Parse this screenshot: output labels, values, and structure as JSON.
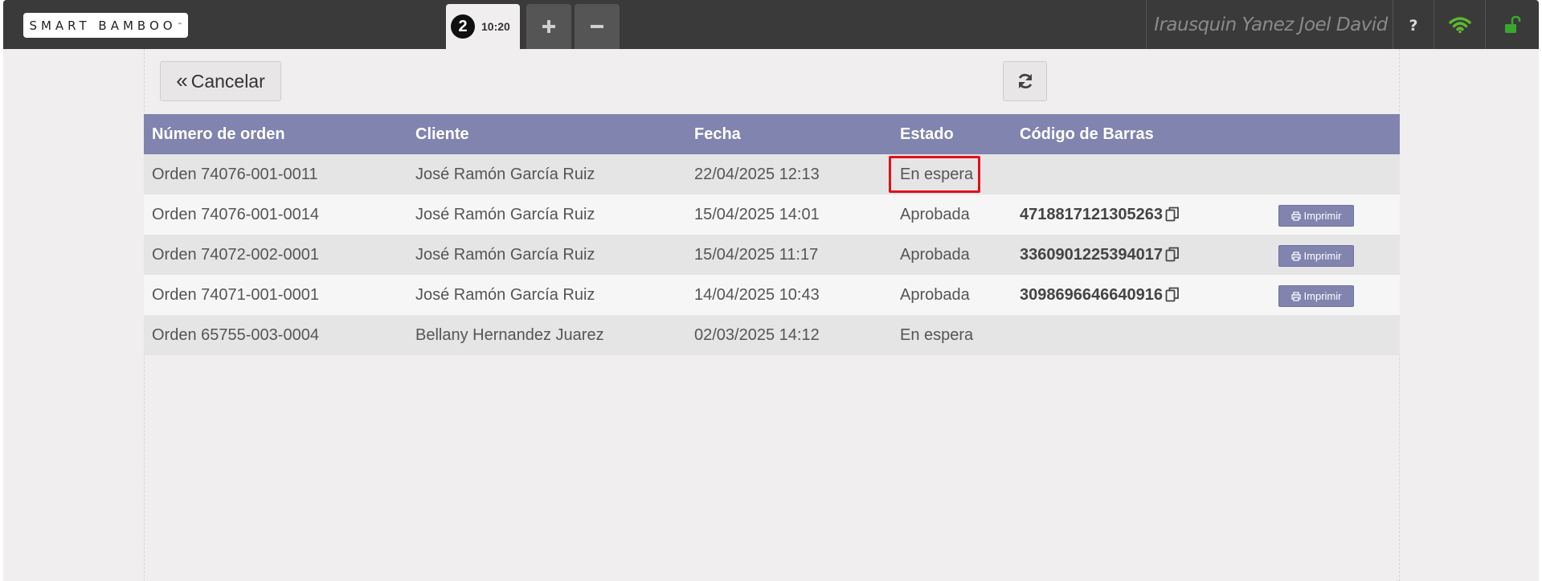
{
  "header": {
    "logo_text": "SMART BAMBOO",
    "active_tab": {
      "number": "2",
      "time": "10:20"
    },
    "add_tab_icon": "plus-icon",
    "remove_tab_icon": "minus-icon",
    "user_name": "Irausquin Yanez Joel David",
    "icons": [
      "help-icon",
      "wifi-icon",
      "unlock-icon"
    ],
    "colors": {
      "wifi": "#5cb82e",
      "unlock": "#3aa530"
    }
  },
  "toolbar": {
    "cancel_label": "Cancelar",
    "refresh_icon": "refresh-icon"
  },
  "table": {
    "columns": [
      "Número de orden",
      "Cliente",
      "Fecha",
      "Estado",
      "Código de Barras"
    ],
    "rows": [
      {
        "order": "Orden 74076-001-0011",
        "client": "José Ramón García Ruiz",
        "date": "22/04/2025 12:13",
        "status": "En espera",
        "barcode": "",
        "print": ""
      },
      {
        "order": "Orden 74076-001-0014",
        "client": "José Ramón García Ruiz",
        "date": "15/04/2025 14:01",
        "status": "Aprobada",
        "barcode": "4718817121305263",
        "print": "Imprimir"
      },
      {
        "order": "Orden 74072-002-0001",
        "client": "José Ramón García Ruiz",
        "date": "15/04/2025 11:17",
        "status": "Aprobada",
        "barcode": "3360901225394017",
        "print": "Imprimir"
      },
      {
        "order": "Orden 74071-001-0001",
        "client": "José Ramón García Ruiz",
        "date": "14/04/2025 10:43",
        "status": "Aprobada",
        "barcode": "3098696646640916",
        "print": "Imprimir"
      },
      {
        "order": "Orden 65755-003-0004",
        "client": "Bellany Hernandez Juarez",
        "date": "02/03/2025 14:12",
        "status": "En espera",
        "barcode": "",
        "print": ""
      }
    ],
    "header_color": "#8084ae",
    "highlight_color": "#e0101a"
  }
}
